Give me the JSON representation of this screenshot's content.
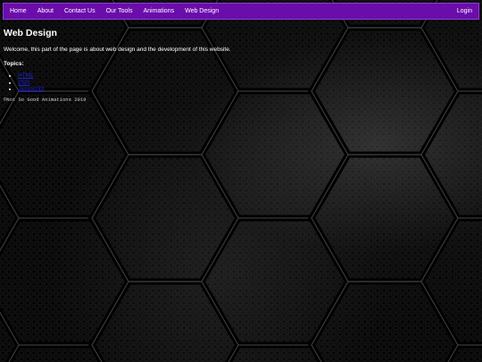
{
  "nav": {
    "items": [
      {
        "label": "Home"
      },
      {
        "label": "About"
      },
      {
        "label": "Contact Us"
      },
      {
        "label": "Our Tools"
      },
      {
        "label": "Animations"
      },
      {
        "label": "Web Design"
      }
    ],
    "login_label": "Login"
  },
  "main": {
    "title": "Web Design",
    "intro": "Welcome, this part of the page is about web design and the development of this website.",
    "topics_label": "Topics:",
    "topics": [
      {
        "label": "HTML"
      },
      {
        "label": "CSS"
      },
      {
        "label": "Javascript"
      }
    ]
  },
  "footer": {
    "text": "©Not So Good Animations 2019"
  },
  "colors": {
    "navbar": "#6b0dab",
    "link": "#2222cc",
    "background": "#0b0b0b"
  }
}
